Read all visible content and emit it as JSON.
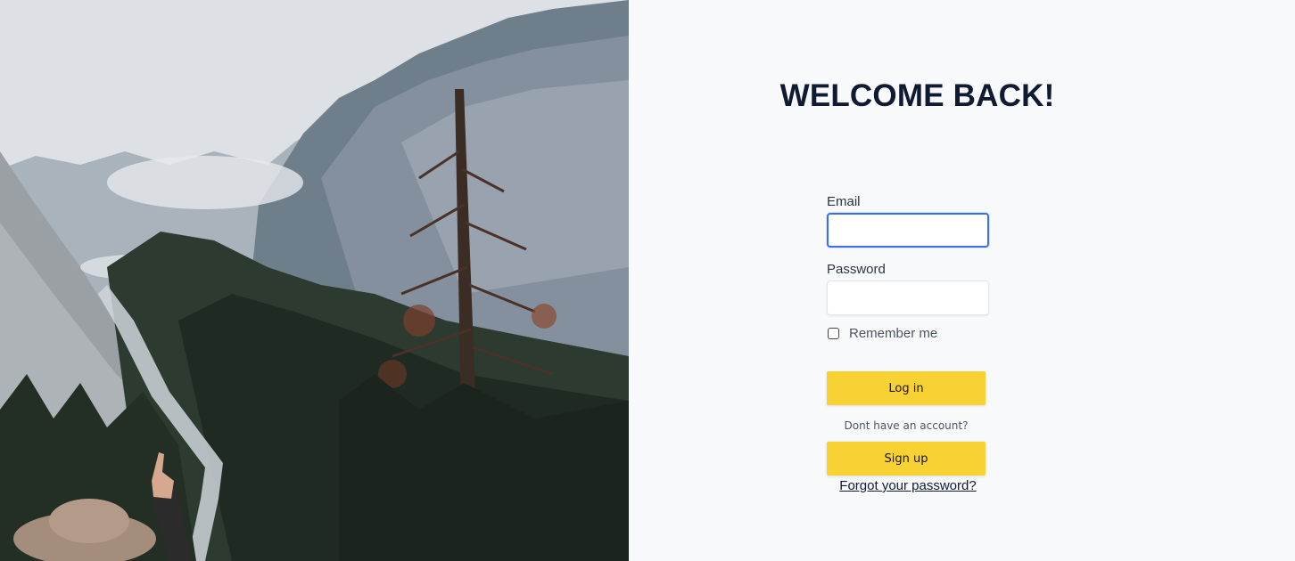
{
  "heading": "WELCOME BACK!",
  "form": {
    "email_label": "Email",
    "email_value": "",
    "password_label": "Password",
    "password_value": "",
    "remember_label": "Remember me",
    "remember_checked": false,
    "login_label": "Log in",
    "no_account_text": "Dont have an account?",
    "signup_label": "Sign up",
    "forgot_label": "Forgot your password?"
  },
  "colors": {
    "accent_button": "#f8d132",
    "heading": "#101a33",
    "focus_ring": "#3b6ef2",
    "background": "#f8f9fb"
  },
  "hero": {
    "description_icon": "mountain-landscape-photo"
  }
}
